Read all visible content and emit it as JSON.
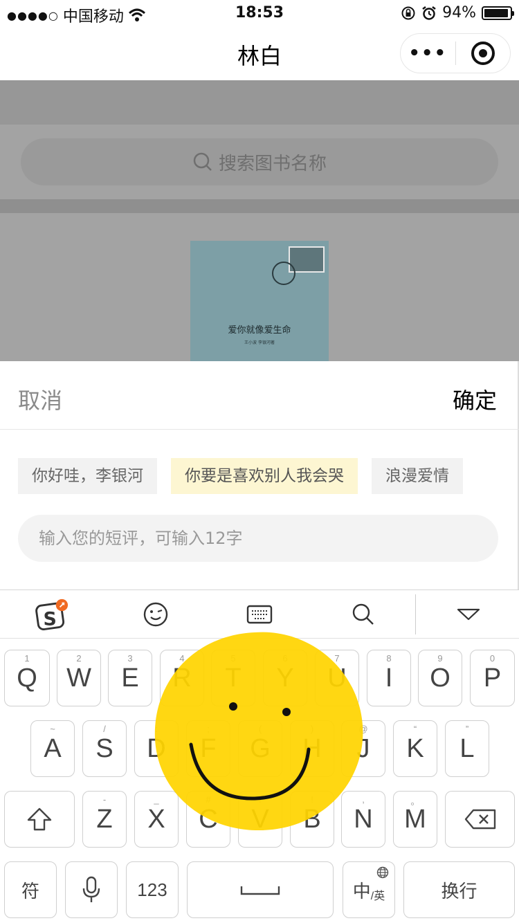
{
  "status": {
    "carrier": "中国移动",
    "time": "18:53",
    "battery": "94%"
  },
  "nav": {
    "title": "林白"
  },
  "background": {
    "search_placeholder": "搜索图书名称",
    "book": {
      "title": "爱你就像爱生命",
      "subtitle": "王小波 李银河著"
    }
  },
  "sheet": {
    "cancel": "取消",
    "confirm": "确定",
    "tags": [
      {
        "label": "你好哇，李银河",
        "selected": false
      },
      {
        "label": "你要是喜欢别人我会哭",
        "selected": true
      },
      {
        "label": "浪漫爱情",
        "selected": false
      }
    ],
    "review_placeholder": "输入您的短评，可输入12字"
  },
  "keyboard": {
    "row1": [
      {
        "label": "Q",
        "hint": "1"
      },
      {
        "label": "W",
        "hint": "2"
      },
      {
        "label": "E",
        "hint": "3"
      },
      {
        "label": "R",
        "hint": "4"
      },
      {
        "label": "T",
        "hint": "5"
      },
      {
        "label": "Y",
        "hint": "6"
      },
      {
        "label": "U",
        "hint": "7"
      },
      {
        "label": "I",
        "hint": "8"
      },
      {
        "label": "O",
        "hint": "9"
      },
      {
        "label": "P",
        "hint": "0"
      }
    ],
    "row2": [
      {
        "label": "A",
        "hint": "~"
      },
      {
        "label": "S",
        "hint": "/"
      },
      {
        "label": "D",
        "hint": ":"
      },
      {
        "label": "F",
        "hint": ";"
      },
      {
        "label": "G",
        "hint": "("
      },
      {
        "label": "H",
        "hint": ")"
      },
      {
        "label": "J",
        "hint": "@"
      },
      {
        "label": "K",
        "hint": "“"
      },
      {
        "label": "L",
        "hint": "”"
      }
    ],
    "row3": [
      {
        "label": "Z",
        "hint": "-"
      },
      {
        "label": "X",
        "hint": "_"
      },
      {
        "label": "C",
        "hint": "#"
      },
      {
        "label": "V",
        "hint": "?"
      },
      {
        "label": "B",
        "hint": "!"
      },
      {
        "label": "N",
        "hint": ","
      },
      {
        "label": "M",
        "hint": "。"
      }
    ],
    "symbols": "符",
    "numbers": "123",
    "lang_main": "中",
    "lang_sub": "/英",
    "return": "换行"
  }
}
